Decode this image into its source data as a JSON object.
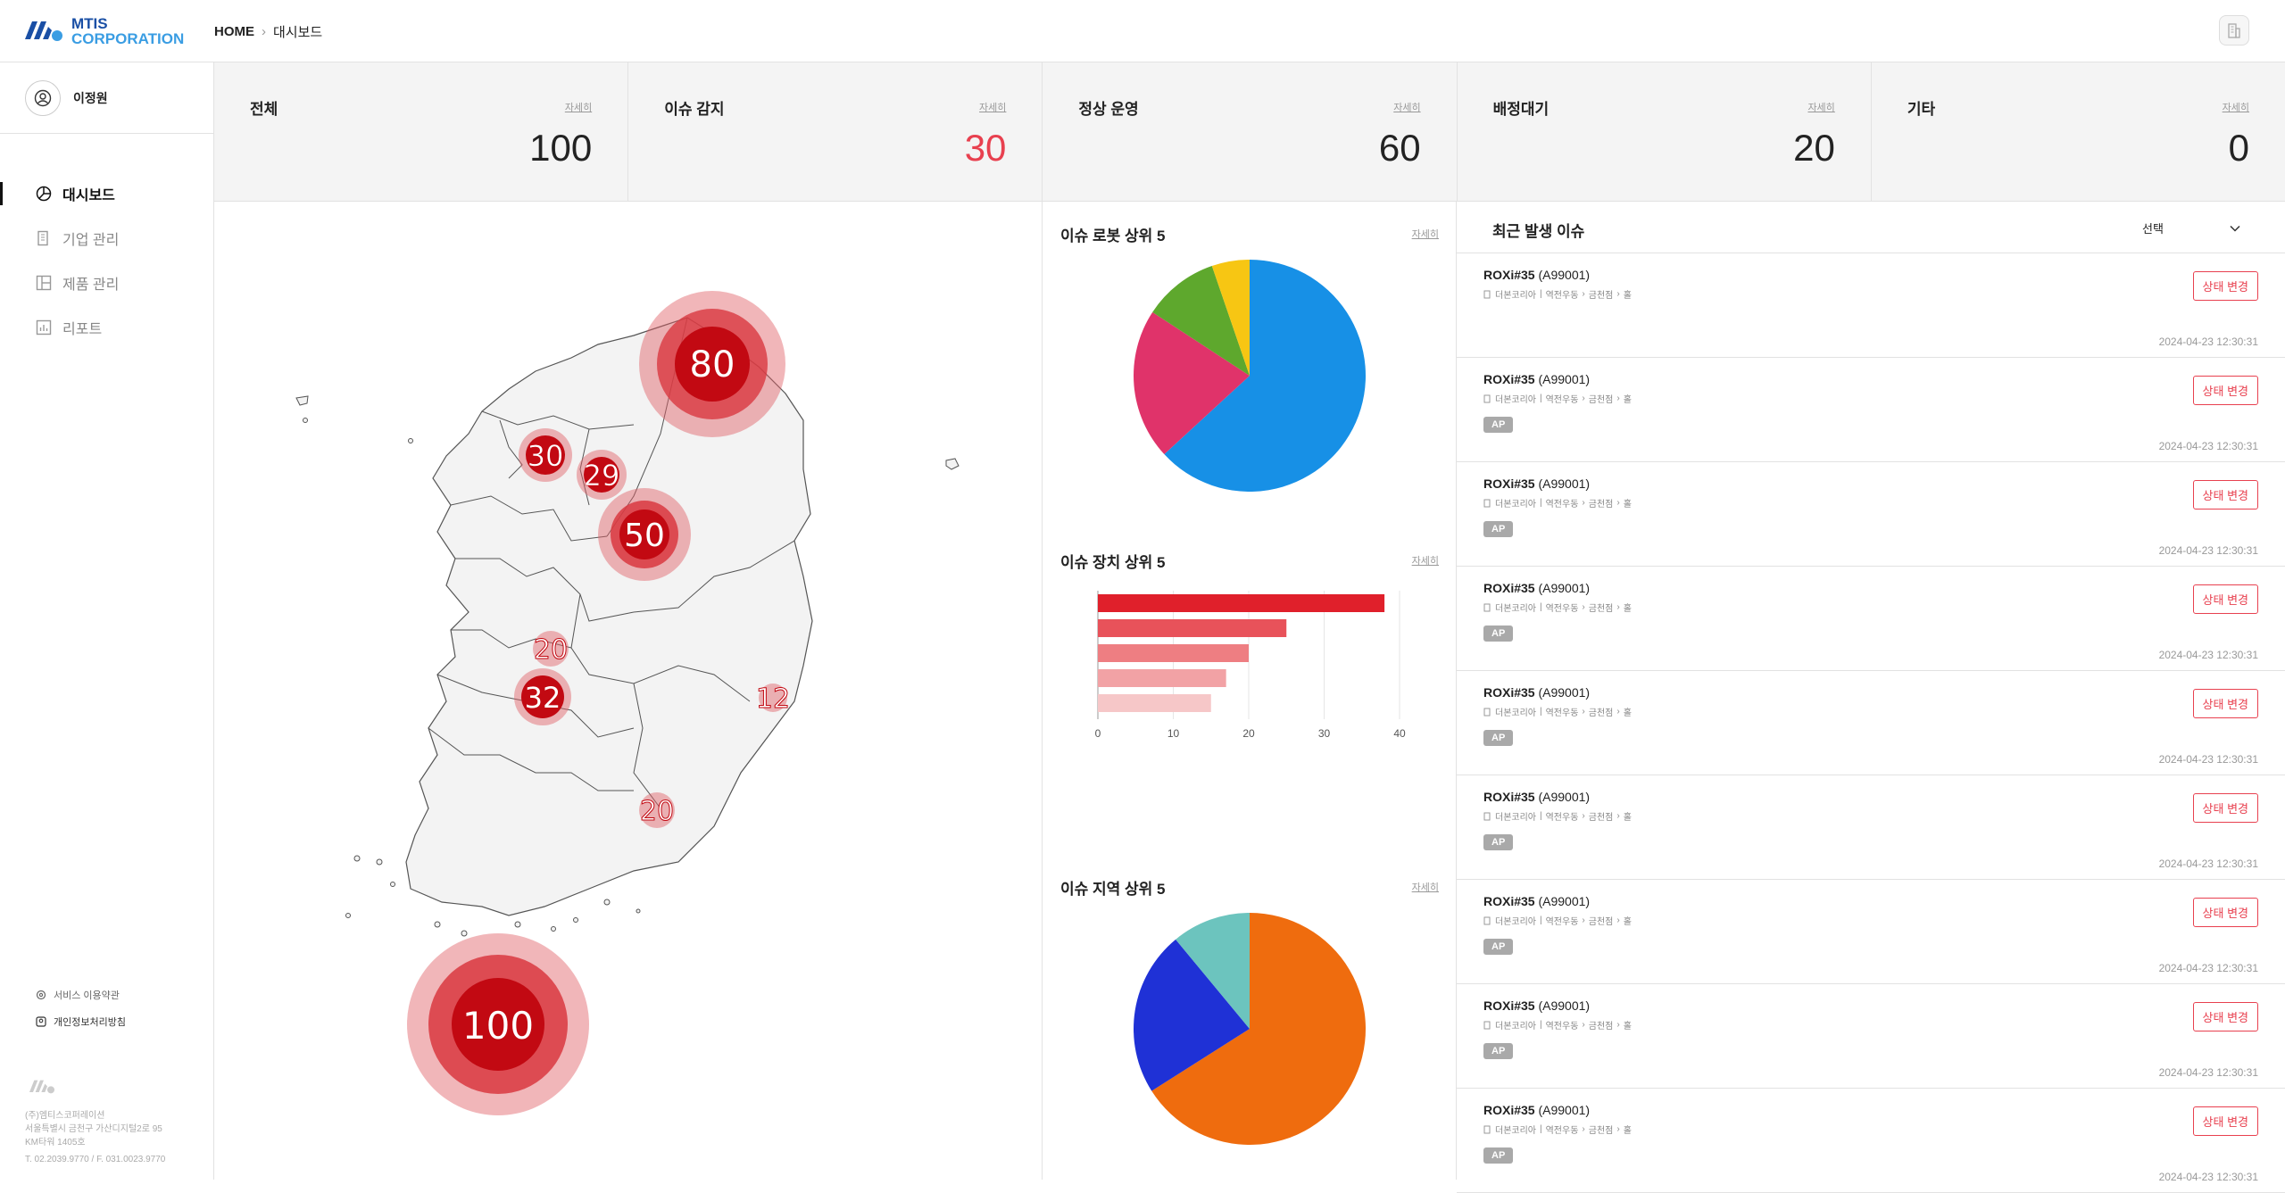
{
  "header": {
    "logo_line1": "MTIS",
    "logo_line2": "CORPORATION",
    "breadcrumb_home": "HOME",
    "breadcrumb_sep": "›",
    "breadcrumb_current": "대시보드"
  },
  "sidebar": {
    "user_name": "이정원",
    "items": [
      {
        "label": "대시보드",
        "icon": "pie-chart-icon",
        "active": true
      },
      {
        "label": "기업 관리",
        "icon": "building-icon"
      },
      {
        "label": "제품 관리",
        "icon": "layout-icon"
      },
      {
        "label": "리포트",
        "icon": "bar-chart-icon"
      }
    ],
    "links": [
      {
        "label": "서비스 이용약관"
      },
      {
        "label": "개인정보처리방침"
      }
    ],
    "footer": {
      "company": "(주)엠티스코퍼레이션",
      "address1": "서울특별시 금천구 가산디지털2로 95",
      "address2": "KM타워 1405호",
      "contact": "T. 02.2039.9770 / F. 031.0023.9770"
    }
  },
  "stats": [
    {
      "label": "전체",
      "detail": "자세히",
      "value": "100"
    },
    {
      "label": "이슈 감지",
      "detail": "자세히",
      "value": "30"
    },
    {
      "label": "정상 운영",
      "detail": "자세히",
      "value": "60"
    },
    {
      "label": "배정대기",
      "detail": "자세히",
      "value": "20"
    },
    {
      "label": "기타",
      "detail": "자세히",
      "value": "0"
    }
  ],
  "map": {
    "clusters": [
      "80",
      "30",
      "29",
      "50",
      "20",
      "32",
      "12",
      "20",
      "100"
    ]
  },
  "charts": {
    "robots": {
      "title": "이슈 로봇 상위 5",
      "detail": "자세히"
    },
    "devices": {
      "title": "이슈 장치 상위 5",
      "detail": "자세히"
    },
    "regions": {
      "title": "이슈 지역 상위 5",
      "detail": "자세히"
    }
  },
  "chart_data": [
    {
      "type": "pie",
      "values": [
        60,
        20,
        10,
        5
      ],
      "colors": [
        "#1790e6",
        "#e0336a",
        "#5ea82d",
        "#f7c613"
      ]
    },
    {
      "type": "bar",
      "orientation": "horizontal",
      "values": [
        38,
        25,
        20,
        17,
        15
      ],
      "xlim": [
        0,
        40
      ],
      "xticks": [
        "0",
        "10",
        "20",
        "30",
        "40"
      ],
      "colors": [
        "#e0202b",
        "#e8525a",
        "#ee7e82",
        "#f2a2a5",
        "#f6c7c8"
      ]
    },
    {
      "type": "pie",
      "values": [
        66,
        23,
        11
      ],
      "colors": [
        "#ef6c0e",
        "#1f31d6",
        "#6cc4be"
      ]
    }
  ],
  "issues": {
    "title": "최근 발생 이슈",
    "select_label": "선택",
    "items": [
      {
        "name": "ROXi#35",
        "code": "(A99001)",
        "path": [
          "더본코리아",
          "역전우동",
          "금천점",
          "홀"
        ],
        "tag": "",
        "button": "상태 변경",
        "time": "2024-04-23 12:30:31"
      },
      {
        "name": "ROXi#35",
        "code": "(A99001)",
        "path": [
          "더본코리아",
          "역전우동",
          "금천점",
          "홀"
        ],
        "tag": "AP",
        "button": "상태 변경",
        "time": "2024-04-23 12:30:31"
      },
      {
        "name": "ROXi#35",
        "code": "(A99001)",
        "path": [
          "더본코리아",
          "역전우동",
          "금천점",
          "홀"
        ],
        "tag": "AP",
        "button": "상태 변경",
        "time": "2024-04-23 12:30:31"
      },
      {
        "name": "ROXi#35",
        "code": "(A99001)",
        "path": [
          "더본코리아",
          "역전우동",
          "금천점",
          "홀"
        ],
        "tag": "AP",
        "button": "상태 변경",
        "time": "2024-04-23 12:30:31"
      },
      {
        "name": "ROXi#35",
        "code": "(A99001)",
        "path": [
          "더본코리아",
          "역전우동",
          "금천점",
          "홀"
        ],
        "tag": "AP",
        "button": "상태 변경",
        "time": "2024-04-23 12:30:31"
      },
      {
        "name": "ROXi#35",
        "code": "(A99001)",
        "path": [
          "더본코리아",
          "역전우동",
          "금천점",
          "홀"
        ],
        "tag": "AP",
        "button": "상태 변경",
        "time": "2024-04-23 12:30:31"
      },
      {
        "name": "ROXi#35",
        "code": "(A99001)",
        "path": [
          "더본코리아",
          "역전우동",
          "금천점",
          "홀"
        ],
        "tag": "AP",
        "button": "상태 변경",
        "time": "2024-04-23 12:30:31"
      },
      {
        "name": "ROXi#35",
        "code": "(A99001)",
        "path": [
          "더본코리아",
          "역전우동",
          "금천점",
          "홀"
        ],
        "tag": "AP",
        "button": "상태 변경",
        "time": "2024-04-23 12:30:31"
      },
      {
        "name": "ROXi#35",
        "code": "(A99001)",
        "path": [
          "더본코리아",
          "역전우동",
          "금천점",
          "홀"
        ],
        "tag": "AP",
        "button": "상태 변경",
        "time": "2024-04-23 12:30:31"
      }
    ]
  }
}
